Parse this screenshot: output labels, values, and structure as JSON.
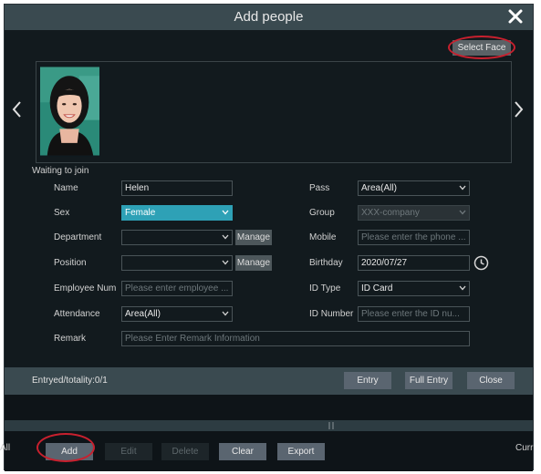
{
  "dialog": {
    "title": "Add people",
    "select_face": "Select Face"
  },
  "form": {
    "waiting_label": "Waiting to join",
    "name": {
      "label": "Name",
      "value": "Helen"
    },
    "sex": {
      "label": "Sex",
      "value": "Female"
    },
    "department": {
      "label": "Department",
      "value": "",
      "manage": "Manage"
    },
    "position": {
      "label": "Position",
      "value": "",
      "manage": "Manage"
    },
    "employee_num": {
      "label": "Employee Num",
      "placeholder": "Please enter employee ..."
    },
    "attendance": {
      "label": "Attendance",
      "value": "Area(All)"
    },
    "remark": {
      "label": "Remark",
      "placeholder": "Please Enter Remark Information"
    },
    "pass": {
      "label": "Pass",
      "value": "Area(All)"
    },
    "group": {
      "label": "Group",
      "value": "XXX-company"
    },
    "mobile": {
      "label": "Mobile",
      "placeholder": "Please enter the phone ..."
    },
    "birthday": {
      "label": "Birthday",
      "value": "2020/07/27"
    },
    "id_type": {
      "label": "ID Type",
      "value": "ID Card"
    },
    "id_number": {
      "label": "ID Number",
      "placeholder": "Please enter the ID nu..."
    }
  },
  "status": {
    "entry_totality": "Entryed/totality:0/1",
    "entry": "Entry",
    "full_entry": "Full Entry",
    "close": "Close"
  },
  "bottom": {
    "left_edge": "All",
    "add": "Add",
    "edit": "Edit",
    "delete": "Delete",
    "clear": "Clear",
    "export": "Export",
    "right_edge": "Curr"
  },
  "icons": {
    "close": "close-icon",
    "prev": "chevron-left-icon",
    "next": "chevron-right-icon",
    "dropdown": "chevron-down-icon",
    "clock": "clock-icon"
  },
  "colors": {
    "titlebar": "#3a4a50",
    "dialog_bg": "#121a1e",
    "accent_selected": "#2ea1b6",
    "annotation_circle": "#c8202e"
  }
}
